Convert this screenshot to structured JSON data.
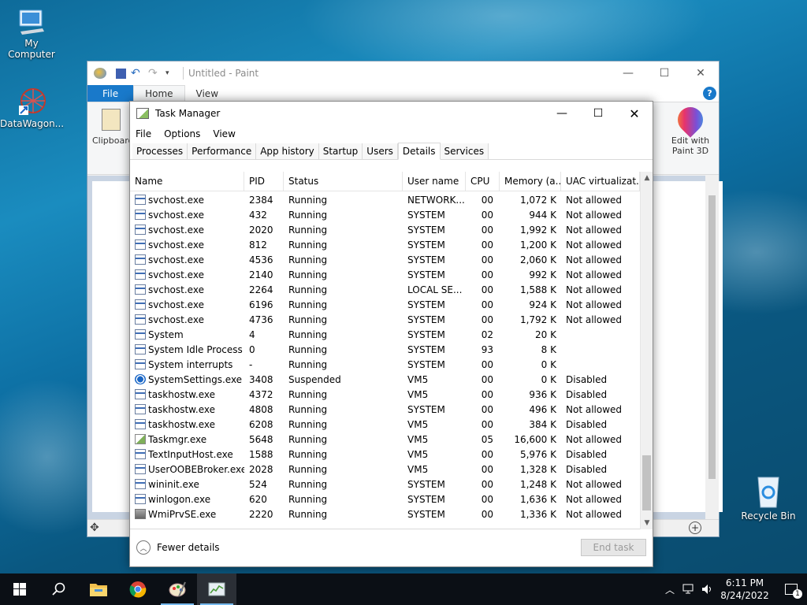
{
  "desktop": {
    "icons": [
      {
        "label": "My Computer"
      },
      {
        "label": "DataWagon..."
      },
      {
        "label": "Recycle Bin"
      }
    ]
  },
  "paint": {
    "title": "Untitled - Paint",
    "tabs": [
      "File",
      "Home",
      "View"
    ],
    "ribbon": {
      "clipboard_label": "Clipboard",
      "edit3d_label": "Edit with\nPaint 3D"
    },
    "accent": "#1979ca"
  },
  "taskmanager": {
    "title": "Task Manager",
    "menu": [
      "File",
      "Options",
      "View"
    ],
    "tabs": [
      "Processes",
      "Performance",
      "App history",
      "Startup",
      "Users",
      "Details",
      "Services"
    ],
    "active_tab": "Details",
    "columns": [
      "Name",
      "PID",
      "Status",
      "User name",
      "CPU",
      "Memory (a...",
      "UAC virtualizat..."
    ],
    "rows": [
      {
        "name": "svchost.exe",
        "pid": "2384",
        "status": "Running",
        "user": "NETWORK...",
        "cpu": "00",
        "mem": "1,072 K",
        "uac": "Not allowed",
        "icon": "process-icon"
      },
      {
        "name": "svchost.exe",
        "pid": "432",
        "status": "Running",
        "user": "SYSTEM",
        "cpu": "00",
        "mem": "944 K",
        "uac": "Not allowed",
        "icon": "process-icon"
      },
      {
        "name": "svchost.exe",
        "pid": "2020",
        "status": "Running",
        "user": "SYSTEM",
        "cpu": "00",
        "mem": "1,992 K",
        "uac": "Not allowed",
        "icon": "process-icon"
      },
      {
        "name": "svchost.exe",
        "pid": "812",
        "status": "Running",
        "user": "SYSTEM",
        "cpu": "00",
        "mem": "1,200 K",
        "uac": "Not allowed",
        "icon": "process-icon"
      },
      {
        "name": "svchost.exe",
        "pid": "4536",
        "status": "Running",
        "user": "SYSTEM",
        "cpu": "00",
        "mem": "2,060 K",
        "uac": "Not allowed",
        "icon": "process-icon"
      },
      {
        "name": "svchost.exe",
        "pid": "2140",
        "status": "Running",
        "user": "SYSTEM",
        "cpu": "00",
        "mem": "992 K",
        "uac": "Not allowed",
        "icon": "process-icon"
      },
      {
        "name": "svchost.exe",
        "pid": "2264",
        "status": "Running",
        "user": "LOCAL SE...",
        "cpu": "00",
        "mem": "1,588 K",
        "uac": "Not allowed",
        "icon": "process-icon"
      },
      {
        "name": "svchost.exe",
        "pid": "6196",
        "status": "Running",
        "user": "SYSTEM",
        "cpu": "00",
        "mem": "924 K",
        "uac": "Not allowed",
        "icon": "process-icon"
      },
      {
        "name": "svchost.exe",
        "pid": "4736",
        "status": "Running",
        "user": "SYSTEM",
        "cpu": "00",
        "mem": "1,792 K",
        "uac": "Not allowed",
        "icon": "process-icon"
      },
      {
        "name": "System",
        "pid": "4",
        "status": "Running",
        "user": "SYSTEM",
        "cpu": "02",
        "mem": "20 K",
        "uac": "",
        "icon": "process-icon"
      },
      {
        "name": "System Idle Process",
        "pid": "0",
        "status": "Running",
        "user": "SYSTEM",
        "cpu": "93",
        "mem": "8 K",
        "uac": "",
        "icon": "process-icon"
      },
      {
        "name": "System interrupts",
        "pid": "-",
        "status": "Running",
        "user": "SYSTEM",
        "cpu": "00",
        "mem": "0 K",
        "uac": "",
        "icon": "process-icon"
      },
      {
        "name": "SystemSettings.exe",
        "pid": "3408",
        "status": "Suspended",
        "user": "VM5",
        "cpu": "00",
        "mem": "0 K",
        "uac": "Disabled",
        "icon": "gear-icon"
      },
      {
        "name": "taskhostw.exe",
        "pid": "4372",
        "status": "Running",
        "user": "VM5",
        "cpu": "00",
        "mem": "936 K",
        "uac": "Disabled",
        "icon": "process-icon"
      },
      {
        "name": "taskhostw.exe",
        "pid": "4808",
        "status": "Running",
        "user": "SYSTEM",
        "cpu": "00",
        "mem": "496 K",
        "uac": "Not allowed",
        "icon": "process-icon"
      },
      {
        "name": "taskhostw.exe",
        "pid": "6208",
        "status": "Running",
        "user": "VM5",
        "cpu": "00",
        "mem": "384 K",
        "uac": "Disabled",
        "icon": "process-icon"
      },
      {
        "name": "Taskmgr.exe",
        "pid": "5648",
        "status": "Running",
        "user": "VM5",
        "cpu": "05",
        "mem": "16,600 K",
        "uac": "Not allowed",
        "icon": "task-manager-icon"
      },
      {
        "name": "TextInputHost.exe",
        "pid": "1588",
        "status": "Running",
        "user": "VM5",
        "cpu": "00",
        "mem": "5,976 K",
        "uac": "Disabled",
        "icon": "process-icon"
      },
      {
        "name": "UserOOBEBroker.exe",
        "pid": "2028",
        "status": "Running",
        "user": "VM5",
        "cpu": "00",
        "mem": "1,328 K",
        "uac": "Disabled",
        "icon": "process-icon"
      },
      {
        "name": "wininit.exe",
        "pid": "524",
        "status": "Running",
        "user": "SYSTEM",
        "cpu": "00",
        "mem": "1,248 K",
        "uac": "Not allowed",
        "icon": "process-icon"
      },
      {
        "name": "winlogon.exe",
        "pid": "620",
        "status": "Running",
        "user": "SYSTEM",
        "cpu": "00",
        "mem": "1,636 K",
        "uac": "Not allowed",
        "icon": "process-icon"
      },
      {
        "name": "WmiPrvSE.exe",
        "pid": "2220",
        "status": "Running",
        "user": "SYSTEM",
        "cpu": "00",
        "mem": "1,336 K",
        "uac": "Not allowed",
        "icon": "wmi-icon"
      }
    ],
    "footer": {
      "fewer_details": "Fewer details",
      "end_task": "End task"
    }
  },
  "taskbar": {
    "time": "6:11 PM",
    "date": "8/24/2022",
    "notification_count": "1",
    "apps": [
      "start-icon",
      "search-icon",
      "file-explorer-icon",
      "chrome-icon",
      "paint-icon",
      "task-manager-icon"
    ]
  }
}
